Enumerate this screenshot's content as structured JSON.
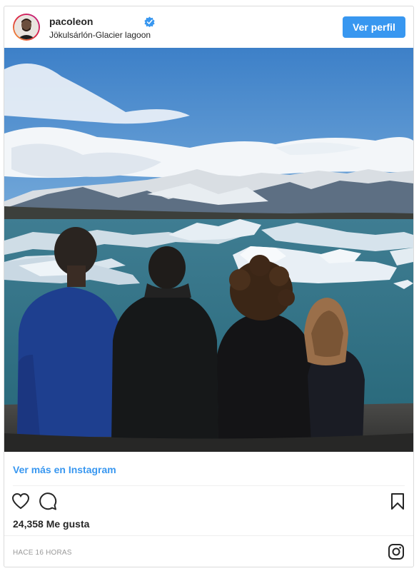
{
  "post": {
    "username": "pacoleon",
    "location": "Jökulsárlón-Glacier lagoon",
    "view_profile_label": "Ver perfil",
    "view_more_label": "Ver más en Instagram",
    "likes_text": "24,358 Me gusta",
    "timestamp": "HACE 16 HORAS",
    "image_alt": "Four people seen from behind sitting at Jökulsárlón glacier lagoon with icebergs and mountains"
  },
  "icons": {
    "verified": "verified-badge-icon",
    "like": "heart-icon",
    "comment": "speech-bubble-icon",
    "save": "bookmark-icon",
    "brand": "instagram-logo-icon"
  },
  "colors": {
    "accent": "#3897f0",
    "text": "#262626",
    "muted": "#999999",
    "border": "#dbdbdb"
  }
}
